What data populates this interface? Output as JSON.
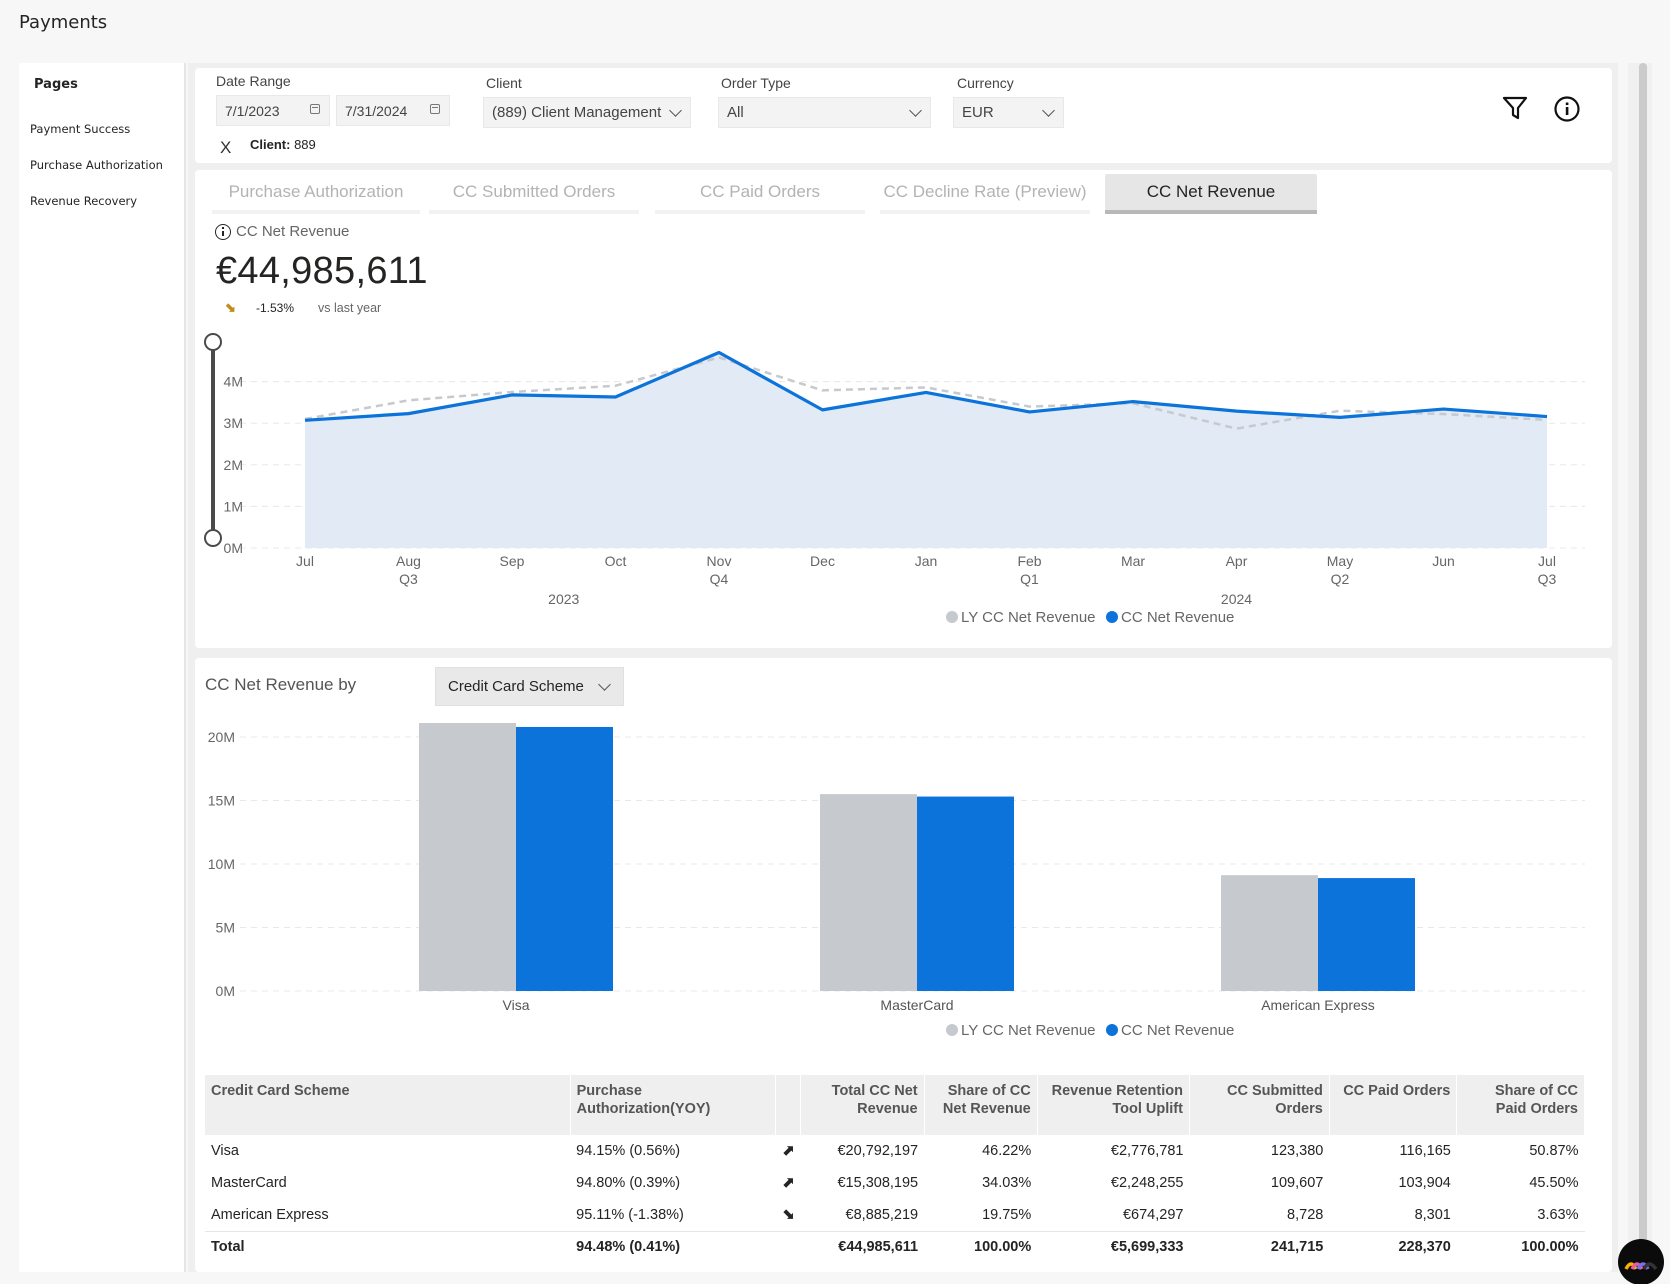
{
  "app": {
    "title": "Payments"
  },
  "sidebar": {
    "title": "Pages",
    "items": [
      {
        "label": "Payment Success"
      },
      {
        "label": "Purchase Authorization"
      },
      {
        "label": "Revenue Recovery"
      }
    ]
  },
  "filters": {
    "date_range": {
      "label": "Date Range",
      "start": "7/1/2023",
      "end": "7/31/2024"
    },
    "client": {
      "label": "Client",
      "value": "(889) Client Management"
    },
    "order_type": {
      "label": "Order Type",
      "value": "All"
    },
    "currency": {
      "label": "Currency",
      "value": "EUR"
    },
    "active_chip": {
      "clear_icon": "X",
      "key": "Client:",
      "value": "889"
    },
    "icons": [
      "filter-icon",
      "info-icon"
    ]
  },
  "tabs": [
    {
      "label": "Purchase Authorization",
      "active": false
    },
    {
      "label": "CC Submitted Orders",
      "active": false
    },
    {
      "label": "CC Paid Orders",
      "active": false
    },
    {
      "label": "CC Decline Rate (Preview)",
      "active": false
    },
    {
      "label": "CC Net Revenue",
      "active": true
    }
  ],
  "kpi": {
    "label": "CC Net Revenue",
    "value": "€44,985,611",
    "trend": "down",
    "delta": "-1.53%",
    "comparison": "vs last year"
  },
  "colors": {
    "primary": "#0b73d9",
    "ly": "#c6c9cd",
    "area": "#e1eaf5",
    "trend": "#c38b1e"
  },
  "chart_data": [
    {
      "type": "area",
      "title": "CC Net Revenue",
      "x": [
        "Jul",
        "Aug",
        "Sep",
        "Oct",
        "Nov",
        "Dec",
        "Jan",
        "Feb",
        "Mar",
        "Apr",
        "May",
        "Jun",
        "Jul"
      ],
      "quarter_labels": [
        "",
        "Q3",
        "",
        "",
        "Q4",
        "",
        "",
        "Q1",
        "",
        "",
        "Q2",
        "",
        "Q3"
      ],
      "year_labels": [
        {
          "label": "2023",
          "at": 2.5
        },
        {
          "label": "2024",
          "at": 9
        }
      ],
      "series": [
        {
          "name": "LY CC Net Revenue",
          "style": "dashed",
          "color": "#c6c9cd",
          "values": [
            3.1,
            3.55,
            3.75,
            3.9,
            4.58,
            3.79,
            3.86,
            3.4,
            3.48,
            2.87,
            3.3,
            3.22,
            3.08
          ]
        },
        {
          "name": "CC Net Revenue",
          "style": "solid-area",
          "color": "#0b73d9",
          "values": [
            3.07,
            3.23,
            3.68,
            3.63,
            4.7,
            3.32,
            3.74,
            3.27,
            3.52,
            3.29,
            3.14,
            3.34,
            3.16
          ]
        }
      ],
      "units": "M EUR",
      "yticks": [
        "0M",
        "1M",
        "2M",
        "3M",
        "4M"
      ],
      "ylim": [
        0,
        4.7
      ],
      "grid": true,
      "legend": "bottom-center"
    },
    {
      "type": "bar",
      "title": "CC Net Revenue by",
      "categories": [
        "Visa",
        "MasterCard",
        "American Express"
      ],
      "series": [
        {
          "name": "LY CC Net Revenue",
          "color": "#c6c9cd",
          "values": [
            21.1,
            15.5,
            9.12
          ]
        },
        {
          "name": "CC Net Revenue",
          "color": "#0b73d9",
          "values": [
            20.79,
            15.31,
            8.89
          ]
        }
      ],
      "units": "M EUR",
      "yticks": [
        "0M",
        "5M",
        "10M",
        "15M",
        "20M"
      ],
      "ylim": [
        0,
        21.1
      ],
      "grid": true,
      "legend": "bottom-center"
    }
  ],
  "breakdown": {
    "dimension_label": "CC Net Revenue by",
    "dimension_value": "Credit Card Scheme"
  },
  "table": {
    "columns": [
      "Credit Card Scheme",
      "Purchase Authorization(YOY)",
      "",
      "Total CC Net Revenue",
      "Share of CC Net Revenue",
      "Revenue Retention Tool Uplift",
      "CC Submitted Orders",
      "CC Paid Orders",
      "Share of CC Paid Orders"
    ],
    "rows": [
      {
        "scheme": "Visa",
        "auth": "94.15% (0.56%)",
        "trend": "up",
        "revenue": "€20,792,197",
        "share_rev": "46.22%",
        "uplift": "€2,776,781",
        "submitted": "123,380",
        "paid": "116,165",
        "share_paid": "50.87%"
      },
      {
        "scheme": "MasterCard",
        "auth": "94.80% (0.39%)",
        "trend": "up",
        "revenue": "€15,308,195",
        "share_rev": "34.03%",
        "uplift": "€2,248,255",
        "submitted": "109,607",
        "paid": "103,904",
        "share_paid": "45.50%"
      },
      {
        "scheme": "American Express",
        "auth": "95.11% (-1.38%)",
        "trend": "down",
        "revenue": "€8,885,219",
        "share_rev": "19.75%",
        "uplift": "€674,297",
        "submitted": "8,728",
        "paid": "8,301",
        "share_paid": "3.63%"
      }
    ],
    "total": {
      "scheme": "Total",
      "auth": "94.48% (0.41%)",
      "revenue": "€44,985,611",
      "share_rev": "100.00%",
      "uplift": "€5,699,333",
      "submitted": "241,715",
      "paid": "228,370",
      "share_paid": "100.00%"
    }
  },
  "symbols": {
    "up": "⬈",
    "down": "⬊"
  }
}
